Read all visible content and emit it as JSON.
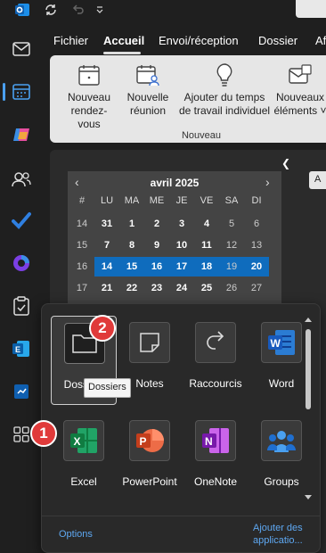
{
  "ribbon_tabs": [
    "Fichier",
    "Accueil",
    "Envoi/réception",
    "Dossier",
    "Af"
  ],
  "active_tab": "Accueil",
  "ribbon_buttons": [
    {
      "line1": "Nouveau",
      "line2": "rendez-vous",
      "icon": "calendar-icon"
    },
    {
      "line1": "Nouvelle",
      "line2": "réunion",
      "icon": "meeting-icon"
    },
    {
      "line1": "Ajouter du temps",
      "line2": "de travail individuel",
      "icon": "lightbulb-icon"
    },
    {
      "line1": "Nouveaux",
      "line2": "éléments ˅",
      "icon": "new-items-icon"
    }
  ],
  "ribbon_group": "Nouveau",
  "calendar": {
    "title": "avril 2025",
    "week_header": "#",
    "days_of_week": [
      "LU",
      "MA",
      "ME",
      "JE",
      "VE",
      "SA",
      "DI"
    ],
    "weeks": [
      {
        "num": "14",
        "days": [
          "31",
          "1",
          "2",
          "3",
          "4",
          "5",
          "6"
        ]
      },
      {
        "num": "15",
        "days": [
          "7",
          "8",
          "9",
          "10",
          "11",
          "12",
          "13"
        ]
      },
      {
        "num": "16",
        "days": [
          "14",
          "15",
          "16",
          "17",
          "18",
          "19",
          "20"
        ]
      },
      {
        "num": "17",
        "days": [
          "21",
          "22",
          "23",
          "24",
          "25",
          "26",
          "27"
        ]
      }
    ]
  },
  "right_button_label": "A",
  "apps": [
    {
      "label": "Dossiers",
      "icon": "folder-icon"
    },
    {
      "label": "Notes",
      "icon": "note-icon"
    },
    {
      "label": "Raccourcis",
      "icon": "shortcut-icon"
    },
    {
      "label": "Word",
      "icon": "word-icon"
    },
    {
      "label": "Excel",
      "icon": "excel-icon"
    },
    {
      "label": "PowerPoint",
      "icon": "powerpoint-icon"
    },
    {
      "label": "OneNote",
      "icon": "onenote-icon"
    },
    {
      "label": "Groups",
      "icon": "groups-icon"
    }
  ],
  "tooltip": "Dossiers",
  "badges": [
    "1",
    "2"
  ],
  "footer": {
    "options": "Options",
    "add_apps_line1": "Ajouter des",
    "add_apps_line2": "applicatio..."
  },
  "colors": {
    "accent": "#0f6cbd",
    "badge": "#e03a3a",
    "link": "#5ea8f2"
  }
}
